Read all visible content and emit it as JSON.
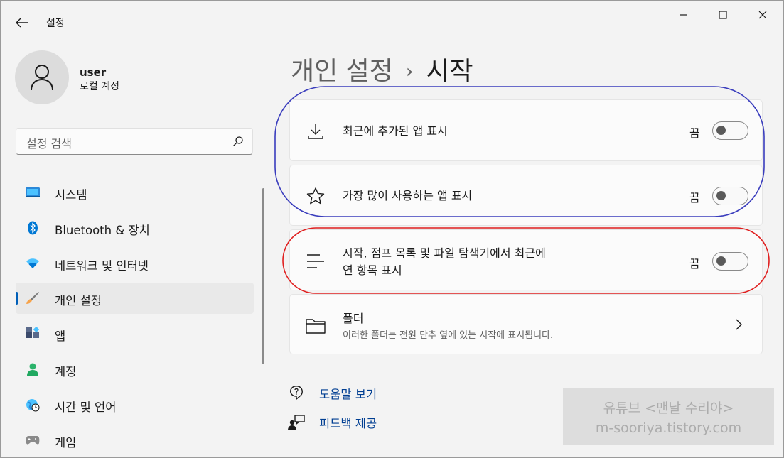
{
  "window": {
    "app_title": "설정",
    "controls": [
      "minimize-icon",
      "maximize-icon",
      "close-icon"
    ]
  },
  "profile": {
    "name": "user",
    "account_type": "로컬 계정"
  },
  "search": {
    "placeholder": "설정 검색"
  },
  "sidebar": {
    "items": [
      {
        "label": "시스템",
        "icon": "monitor-icon"
      },
      {
        "label": "Bluetooth & 장치",
        "icon": "bluetooth-icon"
      },
      {
        "label": "네트워크 및 인터넷",
        "icon": "wifi-icon"
      },
      {
        "label": "개인 설정",
        "icon": "brush-icon",
        "selected": true
      },
      {
        "label": "앱",
        "icon": "apps-icon"
      },
      {
        "label": "계정",
        "icon": "account-icon"
      },
      {
        "label": "시간 및 언어",
        "icon": "globe-clock-icon"
      },
      {
        "label": "게임",
        "icon": "gamepad-icon"
      }
    ]
  },
  "breadcrumb": {
    "parent": "개인 설정",
    "separator": "›",
    "current": "시작"
  },
  "settings": [
    {
      "title": "최근에 추가된 앱 표시",
      "state": "끔",
      "on": false,
      "icon": "download-icon"
    },
    {
      "title": "가장 많이 사용하는 앱 표시",
      "state": "끔",
      "on": false,
      "icon": "star-icon"
    },
    {
      "title_line1": "시작, 점프 목록 및 파일 탐색기에서 최근에",
      "title_line2": "연 항목 표시",
      "state": "끔",
      "on": false,
      "icon": "list-icon"
    },
    {
      "title": "폴더",
      "subtitle": "이러한 폴더는 전원 단추 옆에 있는 시작에 표시됩니다.",
      "icon": "folder-icon"
    }
  ],
  "links": [
    {
      "label": "도움말 보기",
      "icon": "help-icon"
    },
    {
      "label": "피드백 제공",
      "icon": "feedback-icon"
    }
  ],
  "watermark": {
    "line1": "유튜브 <맨날 수리야>",
    "line2": "m-sooriya.tistory.com"
  },
  "colors": {
    "accent": "#005fb8",
    "link": "#003e92",
    "annotation_blue": "#3a3dbd",
    "annotation_red": "#e02020"
  }
}
